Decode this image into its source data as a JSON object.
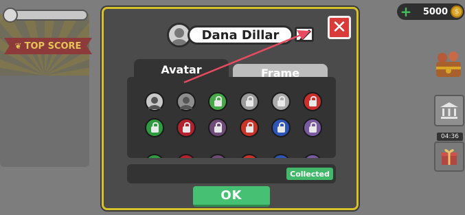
{
  "hud": {
    "top_score_label": "TOP SCORE",
    "coins": "5000",
    "timer": "04:36"
  },
  "dialog": {
    "player_name": "Dana Dillar",
    "tabs": [
      {
        "label": "Avatar",
        "active": true
      },
      {
        "label": "Frame",
        "active": false
      }
    ],
    "status_label": "Collected",
    "ok_label": "OK"
  },
  "avatars": [
    {
      "color": "#c9c9c9",
      "locked": false
    },
    {
      "color": "#8e8e8e",
      "locked": false
    },
    {
      "color": "#46a847",
      "locked": true
    },
    {
      "color": "#9a9a9a",
      "locked": true
    },
    {
      "color": "#aaaaaa",
      "locked": true
    },
    {
      "color": "#c9302c",
      "locked": true
    },
    {
      "color": "#2f9a3f",
      "locked": true
    },
    {
      "color": "#b3222e",
      "locked": true
    },
    {
      "color": "#6f4b78",
      "locked": true
    },
    {
      "color": "#c8342a",
      "locked": true
    },
    {
      "color": "#2d55b5",
      "locked": true
    },
    {
      "color": "#7a5aa0",
      "locked": true
    }
  ],
  "colors": {
    "dialog_border": "#d6c22b",
    "close": "#d93a3a",
    "ok": "#46c072",
    "annotation_arrow": "#e84a5f"
  }
}
